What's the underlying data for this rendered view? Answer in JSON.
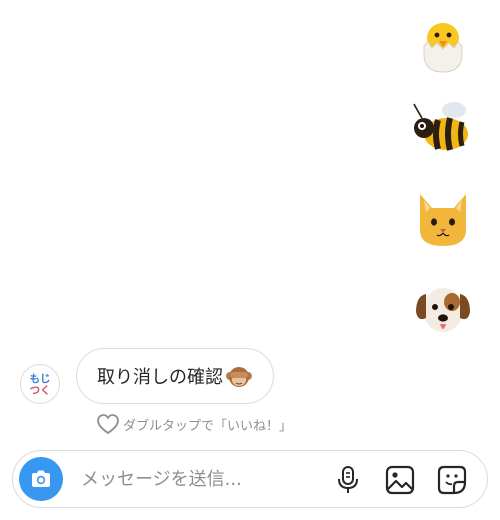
{
  "sent_messages": [
    {
      "emoji": "hatching-chick"
    },
    {
      "emoji": "honeybee"
    },
    {
      "emoji": "cat-face"
    },
    {
      "emoji": "dog-face"
    }
  ],
  "received": {
    "avatar_text": "もじつく",
    "avatar_colors": [
      "#2b7fd4",
      "#d94a6a"
    ],
    "message_text": "取り消しの確認",
    "message_emoji": "see-no-evil-monkey"
  },
  "like_hint": "ダブルタップで「いいね！」",
  "composer": {
    "placeholder": "メッセージを送信...",
    "accent_color": "#3897f0",
    "icons": [
      "camera-icon",
      "microphone-icon",
      "gallery-icon",
      "sticker-icon"
    ]
  }
}
